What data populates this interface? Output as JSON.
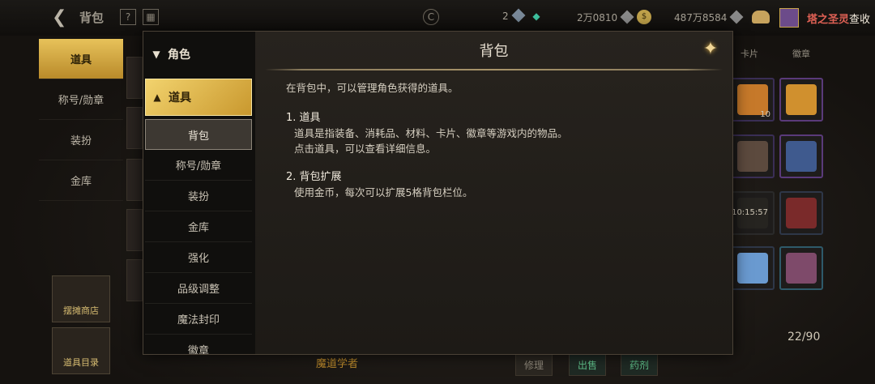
{
  "topbar": {
    "title": "背包",
    "resources": [
      {
        "value": "2",
        "gem_color": "#7a8a9a"
      },
      {
        "value": "2万0810",
        "gem_color": "#8a8a8a"
      },
      {
        "value": "487万8584",
        "gem_color": "#8a8a8a"
      }
    ],
    "user_name_prefix": "塔之圣灵",
    "user_name_suffix": "查收"
  },
  "leftnav": {
    "items": [
      "道具",
      "称号/勋章",
      "装扮",
      "金库"
    ],
    "active_index": 0
  },
  "left_tools": [
    "摆摊商店",
    "道具目录"
  ],
  "right_tabs": [
    "卡片",
    "徽章"
  ],
  "grid_items": [
    {
      "qty": "10"
    },
    {
      "qty": ""
    },
    {
      "qty": ""
    },
    {
      "qty": ""
    },
    {
      "qty": "10:15:57"
    },
    {
      "qty": ""
    },
    {
      "qty": ""
    },
    {
      "qty": ""
    }
  ],
  "capacity": "22/90",
  "bottom_buttons": [
    "修理",
    "出售",
    "药剂"
  ],
  "magic_label": "魔道学者",
  "modal": {
    "title": "背包",
    "close_icon": "sparkle-close-icon",
    "categories": {
      "collapsed_header": "角色",
      "open_header": "道具",
      "sub_items": [
        "背包",
        "称号/勋章",
        "装扮",
        "金库",
        "强化",
        "品级调整",
        "魔法封印",
        "徽章"
      ],
      "selected_index": 0
    },
    "intro": "在背包中，可以管理角色获得的道具。",
    "sections": [
      {
        "title": "1. 道具",
        "lines": [
          "道具是指装备、消耗品、材料、卡片、徽章等游戏内的物品。",
          "点击道具，可以查看详细信息。"
        ]
      },
      {
        "title": "2. 背包扩展",
        "lines": [
          "使用金币，每次可以扩展5格背包栏位。"
        ]
      }
    ]
  }
}
